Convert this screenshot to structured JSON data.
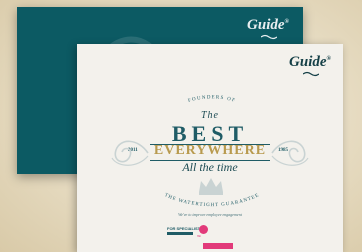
{
  "back_card": {
    "logo_text": "Guide",
    "logo_mark": "®"
  },
  "front_card": {
    "logo_text": "Guide",
    "logo_mark": "®",
    "arc_top": "FOUNDERS OF",
    "script_line1": "The",
    "headline": "BEST",
    "subheadline": "EVERYWHERE",
    "script_line2": "All the time",
    "year_left": "2011",
    "year_right": "1985",
    "arc_bottom": "THE WATERTIGHT GUARANTEE",
    "tagline": "We've to improve employee engagement",
    "partner_label": "FOR SPECIALISTS",
    "partner_brand": "fbb",
    "button_label": ""
  },
  "colors": {
    "back_card": "#0c5a63",
    "front_card": "#f3f1ec",
    "primary_text": "#1f5c66",
    "gold": "#b89a4e",
    "accent_pink": "#e23a7a",
    "background": "#e6dbc1"
  },
  "icons": {
    "logo_leaf": "leaf-flourish-icon",
    "crown": "crown-icon",
    "swirl_left": "ornamental-swirl-icon",
    "swirl_right": "ornamental-swirl-icon"
  }
}
